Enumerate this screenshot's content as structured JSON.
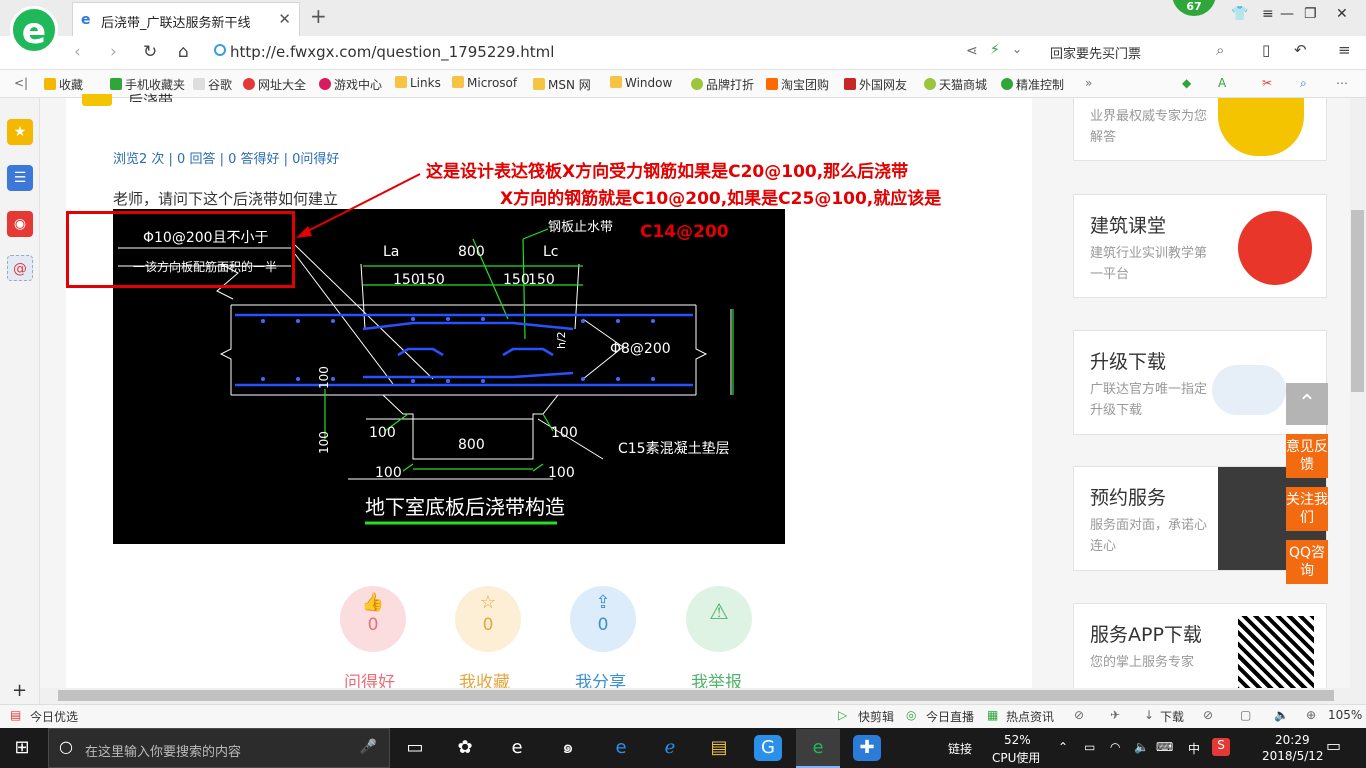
{
  "browser": {
    "tab_title": "后浇带_广联达服务新干线",
    "badge": "67",
    "url": "http://e.fwxgx.com/question_1795229.html",
    "search_placeholder": "回家要先买门票",
    "zoom": "105%"
  },
  "bookmarks": [
    "收藏",
    "手机收藏夹",
    "谷歌",
    "网址大全",
    "游戏中心",
    "Links",
    "Microsof",
    "MSN 网",
    "Window",
    "品牌打折",
    "淘宝团购",
    "外国网友",
    "天猫商城",
    "精准控制"
  ],
  "page": {
    "section_title": "后浇带",
    "stats": "浏览2 次 | 0 回答 | 0 答得好 | 0问得好",
    "question": "老师，请问下这个后浇带如何建立",
    "annotation_line1": "这是设计表达筏板X方向受力钢筋如果是C20@100,那么后浇带",
    "annotation_line2": "X方向的钢筋就是C10@200,如果是C25@100,就应该是",
    "annotation_line3": "C14@200",
    "cad": {
      "note1": "Φ10@200且不小于",
      "note2": "一该方向板配筋面积的一半",
      "label_waterstop": "钢板止水带",
      "label_La": "La",
      "label_Lc": "Lc",
      "dim_800_top": "800",
      "dim_150_1": "150",
      "dim_150_2": "150",
      "dim_150_3": "150",
      "dim_150_4": "150",
      "label_h": "h/2",
      "label_phi": "Φ8@200",
      "dim_100_left": "100",
      "dim_100_vert": "100",
      "dim_100_a": "100",
      "dim_800_bottom": "800",
      "dim_100_b": "100",
      "dim_100_c": "100",
      "dim_100_d": "100",
      "label_c15": "C15素混凝土垫层",
      "title": "地下室底板后浇带构造"
    },
    "actions": [
      {
        "label": "问得好",
        "count": "0",
        "color": "#e9707a",
        "bg": "#fbdde0"
      },
      {
        "label": "我收藏",
        "count": "0",
        "color": "#e7a53e",
        "bg": "#fdefd6"
      },
      {
        "label": "我分享",
        "count": "0",
        "color": "#3f8fd6",
        "bg": "#dcecfa"
      },
      {
        "label": "我举报",
        "count": "",
        "color": "#52b36c",
        "bg": "#def3e3"
      }
    ]
  },
  "sidebar_cards": [
    {
      "title": "",
      "sub": "业界最权威专家为您解答"
    },
    {
      "title": "建筑课堂",
      "sub": "建筑行业实训教学第一平台"
    },
    {
      "title": "升级下载",
      "sub": "广联达官方唯一指定升级下载"
    },
    {
      "title": "预约服务",
      "sub": "服务面对面，承诺心连心"
    },
    {
      "title": "服务APP下载",
      "sub": "您的掌上服务专家"
    }
  ],
  "float_buttons": [
    "意见反馈",
    "关注我们",
    "QQ咨询"
  ],
  "statusbar": {
    "left": "今日优选",
    "items": [
      "快剪辑",
      "今日直播",
      "热点资讯",
      "下载"
    ]
  },
  "taskbar": {
    "search_placeholder": "在这里输入你要搜索的内容",
    "link": "链接",
    "cpu_percent": "52%",
    "cpu_label": "CPU使用",
    "ime": "中",
    "time": "20:29",
    "date": "2018/5/12"
  }
}
